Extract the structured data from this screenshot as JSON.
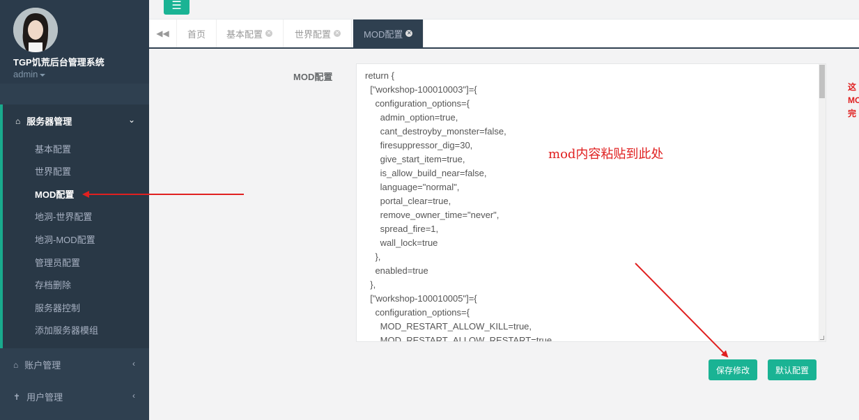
{
  "app": {
    "title": "TGP饥荒后台管理系统",
    "user": "admin"
  },
  "sidebar": {
    "server_group": {
      "label": "服务器管理"
    },
    "items": [
      {
        "label": "基本配置"
      },
      {
        "label": "世界配置"
      },
      {
        "label": "MOD配置",
        "active": true
      },
      {
        "label": "地洞-世界配置"
      },
      {
        "label": "地洞-MOD配置"
      },
      {
        "label": "管理员配置"
      },
      {
        "label": "存档删除"
      },
      {
        "label": "服务器控制"
      },
      {
        "label": "添加服务器模组"
      }
    ],
    "account_group": {
      "label": "账户管理"
    },
    "users_group": {
      "label": "用户管理"
    }
  },
  "topbar": {
    "menu_icon": "hamburger-icon"
  },
  "tabs": [
    {
      "label": "首页"
    },
    {
      "label": "基本配置"
    },
    {
      "label": "世界配置"
    },
    {
      "label": "MOD配置",
      "active": true
    }
  ],
  "form": {
    "label": "MOD配置",
    "content": "return {\n  [\"workshop-100010003\"]={\n    configuration_options={\n      admin_option=true,\n      cant_destroyby_monster=false,\n      firesuppressor_dig=30,\n      give_start_item=true,\n      is_allow_build_near=false,\n      language=\"normal\",\n      portal_clear=true,\n      remove_owner_time=\"never\",\n      spread_fire=1,\n      wall_lock=true\n    },\n    enabled=true\n  },\n  [\"workshop-100010005\"]={\n    configuration_options={\n      MOD_RESTART_ALLOW_KILL=true,\n      MOD_RESTART_ALLOW_RESTART=true",
    "note": "mod内容粘贴到此处",
    "side_hint": "这\nMO\n完"
  },
  "buttons": {
    "save": "保存修改",
    "default": "默认配置"
  },
  "colors": {
    "sidebar": "#2f4050",
    "accent": "#1ab394",
    "annotation": "#e02020"
  }
}
